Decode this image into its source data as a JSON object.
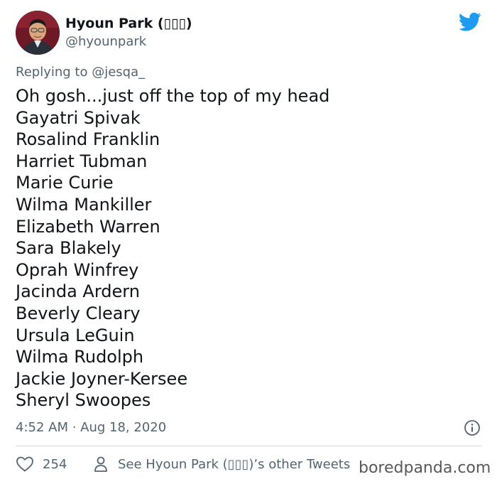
{
  "author": {
    "display_name": "Hyoun Park (▯▯▯)",
    "handle": "@hyounpark"
  },
  "reply": {
    "prefix": "Replying to ",
    "mention": "@jesqa_"
  },
  "tweet": {
    "lines": [
      "Oh gosh...just off the top of my head",
      "Gayatri Spivak",
      "Rosalind Franklin",
      "Harriet Tubman",
      "Marie Curie",
      "Wilma Mankiller",
      "Elizabeth Warren",
      "Sara Blakely",
      "Oprah Winfrey",
      "Jacinda Ardern",
      "Beverly Cleary",
      "Ursula LeGuin",
      "Wilma Rudolph",
      "Jackie Joyner-Kersee",
      "Sheryl Swoopes"
    ],
    "timestamp": "4:52 AM · Aug 18, 2020"
  },
  "actions": {
    "like_count": "254",
    "other_tweets_label": "See Hyoun Park (▯▯▯)’s other Tweets"
  },
  "watermark": "boredpanda.com",
  "colors": {
    "twitter_blue": "#1d9bf0",
    "secondary_text": "#536471",
    "divider": "#cfd9de"
  },
  "icons": {
    "brand": "twitter-bird-icon",
    "info": "info-icon",
    "like": "heart-icon",
    "profile": "person-icon"
  }
}
